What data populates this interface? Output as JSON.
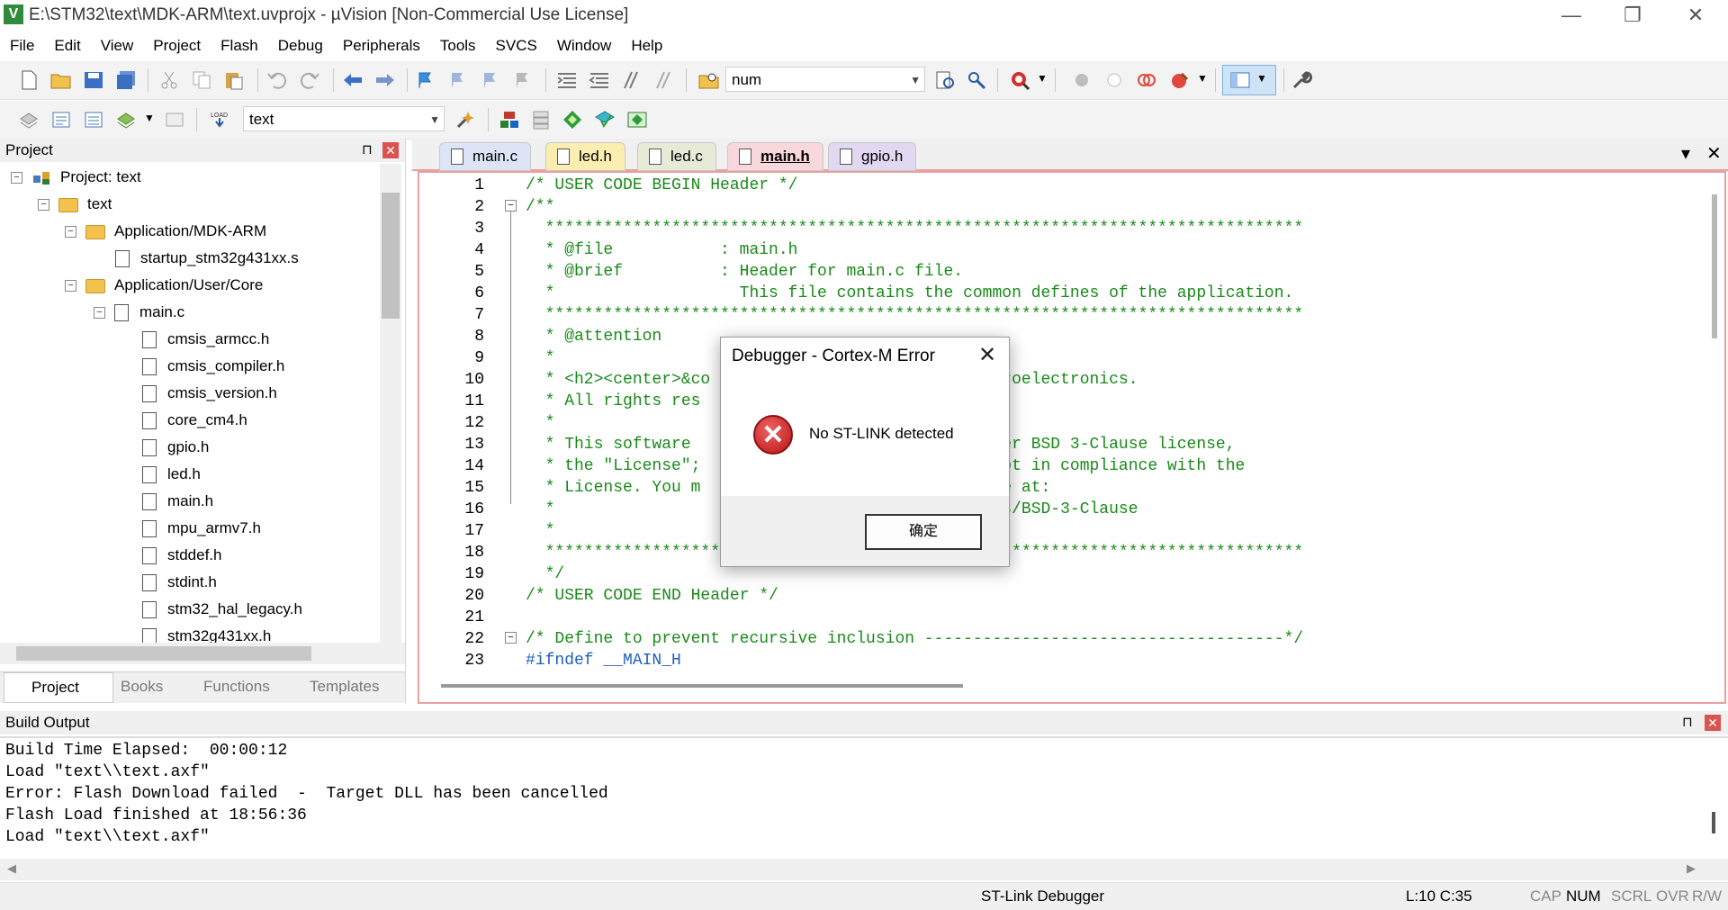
{
  "window": {
    "title": "E:\\STM32\\text\\MDK-ARM\\text.uvprojx - µVision  [Non-Commercial Use License]",
    "app_icon": "V",
    "minimize": "—",
    "restore": "❐",
    "close": "✕"
  },
  "menu": [
    "File",
    "Edit",
    "View",
    "Project",
    "Flash",
    "Debug",
    "Peripherals",
    "Tools",
    "SVCS",
    "Window",
    "Help"
  ],
  "toolbar": {
    "find_value": "num",
    "target_value": "text"
  },
  "project_panel": {
    "title": "Project",
    "pin": "⊓",
    "close": "✕",
    "tree": [
      {
        "label": "Project: text",
        "expander": "−"
      },
      {
        "label": "text",
        "expander": "−"
      },
      {
        "label": "Application/MDK-ARM",
        "expander": "−"
      },
      {
        "label": "startup_stm32g431xx.s"
      },
      {
        "label": "Application/User/Core",
        "expander": "−"
      },
      {
        "label": "main.c",
        "expander": "−"
      },
      {
        "label": "cmsis_armcc.h"
      },
      {
        "label": "cmsis_compiler.h"
      },
      {
        "label": "cmsis_version.h"
      },
      {
        "label": "core_cm4.h"
      },
      {
        "label": "gpio.h"
      },
      {
        "label": "led.h"
      },
      {
        "label": "main.h"
      },
      {
        "label": "mpu_armv7.h"
      },
      {
        "label": "stddef.h"
      },
      {
        "label": "stdint.h"
      },
      {
        "label": "stm32_hal_legacy.h"
      },
      {
        "label": "stm32g431xx.h"
      }
    ],
    "tabs": [
      "Project",
      "Books",
      "Functions",
      "Templates"
    ]
  },
  "editor": {
    "tabs": [
      {
        "label": "main.c",
        "color": "#dde4f5"
      },
      {
        "label": "led.h",
        "color": "#fbeeb0"
      },
      {
        "label": "led.c",
        "color": "#e8ead8"
      },
      {
        "label": "main.h",
        "color": "#f8d7dd"
      },
      {
        "label": "gpio.h",
        "color": "#e2d8f2"
      }
    ],
    "tab_dropdown": "▾",
    "tab_close": "✕",
    "line_numbers": [
      "1",
      "2",
      "3",
      "4",
      "5",
      "6",
      "7",
      "8",
      "9",
      "10",
      "11",
      "12",
      "13",
      "14",
      "15",
      "16",
      "17",
      "18",
      "19",
      "20",
      "21",
      "22",
      "23"
    ],
    "lines": [
      "/* USER CODE BEGIN Header */",
      "/**",
      "  ******************************************************************************",
      "  * @file           : main.h",
      "  * @brief          : Header for main.c file.",
      "  *                   This file contains the common defines of the application.",
      "  ******************************************************************************",
      "  * @attention",
      "  *",
      "  * <h2><center>&co                            icroelectronics.",
      "  * All rights res",
      "  *",
      "  * This software                             under BSD 3-Clause license,",
      "  * the \"License\";                           except in compliance with the",
      "  * License. You m                            ense at:",
      "  *                                          enses/BSD-3-Clause",
      "  *",
      "  ******************************************************************************",
      "  */",
      "/* USER CODE END Header */",
      "",
      "/* Define to prevent recursive inclusion -------------------------------------*/",
      "#ifndef __MAIN_H"
    ]
  },
  "build_output": {
    "title": "Build Output",
    "pin": "⊓",
    "close": "✕",
    "lines": [
      "Build Time Elapsed:  00:00:12",
      "Load \"text\\\\text.axf\"",
      "Error: Flash Download failed  -  Target DLL has been cancelled",
      "Flash Load finished at 18:56:36",
      "Load \"text\\\\text.axf\""
    ]
  },
  "status": {
    "debugger": "ST-Link Debugger",
    "position": "L:10 C:35",
    "caps": "CAP",
    "num": "NUM",
    "scrl": "SCRL",
    "ovr": "OVR",
    "rw": "R/W"
  },
  "dialog": {
    "title": "Debugger - Cortex-M Error",
    "close": "✕",
    "icon": "✕",
    "message": "No ST-LINK detected",
    "ok": "确定"
  }
}
